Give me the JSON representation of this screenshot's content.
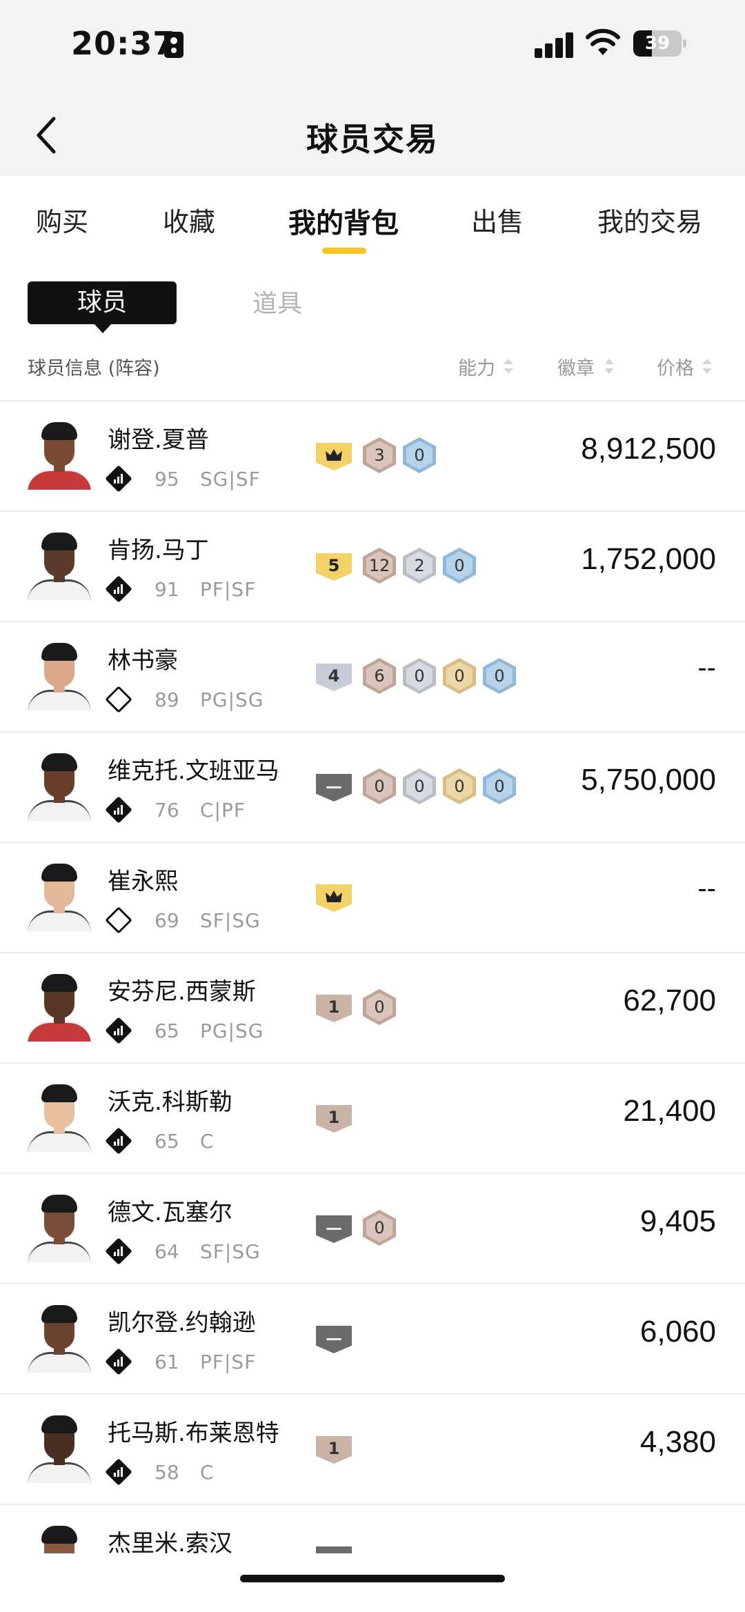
{
  "status_bar": {
    "time": "20:37",
    "battery": "39",
    "battery_level": 0.39
  },
  "header": {
    "title": "球员交易",
    "back_icon": "chevron-left-icon"
  },
  "tabs": [
    {
      "label": "购买",
      "active": false
    },
    {
      "label": "收藏",
      "active": false
    },
    {
      "label": "我的背包",
      "active": true
    },
    {
      "label": "出售",
      "active": false
    },
    {
      "label": "我的交易",
      "active": false
    }
  ],
  "accent_color": "#f3c623",
  "segments": {
    "players": "球员",
    "props": "道具",
    "selected": "球员"
  },
  "columns": {
    "info": "球员信息 (阵容)",
    "ability": "能力",
    "badge": "徽章",
    "price": "价格"
  },
  "players": [
    {
      "name": "谢登.夏普",
      "rating": "95",
      "position": "SG|SF",
      "rank_icon": "bars",
      "ability": {
        "type": "crown",
        "label": ""
      },
      "badges": [
        {
          "tier": "bronze",
          "value": "3"
        },
        {
          "tier": "blue",
          "value": "0"
        }
      ],
      "price": "8,912,500"
    },
    {
      "name": "肯扬.马丁",
      "rating": "91",
      "position": "PF|SF",
      "rank_icon": "03",
      "ability": {
        "type": "gold",
        "label": "5"
      },
      "badges": [
        {
          "tier": "bronze",
          "value": "12"
        },
        {
          "tier": "silver",
          "value": "2"
        },
        {
          "tier": "blue",
          "value": "0"
        }
      ],
      "price": "1,752,000"
    },
    {
      "name": "林书豪",
      "rating": "89",
      "position": "PG|SG",
      "rank_icon": "star",
      "ability": {
        "type": "silver",
        "label": "4"
      },
      "badges": [
        {
          "tier": "bronze",
          "value": "6"
        },
        {
          "tier": "silver",
          "value": "0"
        },
        {
          "tier": "gold",
          "value": "0"
        },
        {
          "tier": "blue",
          "value": "0"
        }
      ],
      "price": "--"
    },
    {
      "name": "维克托.文班亚马",
      "rating": "76",
      "position": "C|PF",
      "rank_icon": "bars",
      "ability": {
        "type": "gray",
        "label": "—"
      },
      "badges": [
        {
          "tier": "bronze",
          "value": "0"
        },
        {
          "tier": "silver",
          "value": "0"
        },
        {
          "tier": "gold",
          "value": "0"
        },
        {
          "tier": "blue",
          "value": "0"
        }
      ],
      "price": "5,750,000"
    },
    {
      "name": "崔永熙",
      "rating": "69",
      "position": "SF|SG",
      "rank_icon": "star",
      "ability": {
        "type": "crown",
        "label": ""
      },
      "badges": [],
      "price": "--"
    },
    {
      "name": "安芬尼.西蒙斯",
      "rating": "65",
      "position": "PG|SG",
      "rank_icon": "bars",
      "ability": {
        "type": "bronze",
        "label": "1"
      },
      "badges": [
        {
          "tier": "bronze",
          "value": "0"
        }
      ],
      "price": "62,700"
    },
    {
      "name": "沃克.科斯勒",
      "rating": "65",
      "position": "C",
      "rank_icon": "bars",
      "ability": {
        "type": "bronze",
        "label": "1"
      },
      "badges": [],
      "price": "21,400"
    },
    {
      "name": "德文.瓦塞尔",
      "rating": "64",
      "position": "SF|SG",
      "rank_icon": "bars",
      "ability": {
        "type": "gray",
        "label": "—"
      },
      "badges": [
        {
          "tier": "bronze",
          "value": "0"
        }
      ],
      "price": "9,405"
    },
    {
      "name": "凯尔登.约翰逊",
      "rating": "61",
      "position": "PF|SF",
      "rank_icon": "bars",
      "ability": {
        "type": "gray",
        "label": "—"
      },
      "badges": [],
      "price": "6,060"
    },
    {
      "name": "托马斯.布莱恩特",
      "rating": "58",
      "position": "C",
      "rank_icon": "bars",
      "ability": {
        "type": "bronze",
        "label": "1"
      },
      "badges": [],
      "price": "4,380"
    },
    {
      "name": "杰里米.索汉",
      "rating": "",
      "position": "",
      "rank_icon": "",
      "ability": {
        "type": "gray",
        "label": ""
      },
      "badges": [],
      "price": ""
    }
  ]
}
